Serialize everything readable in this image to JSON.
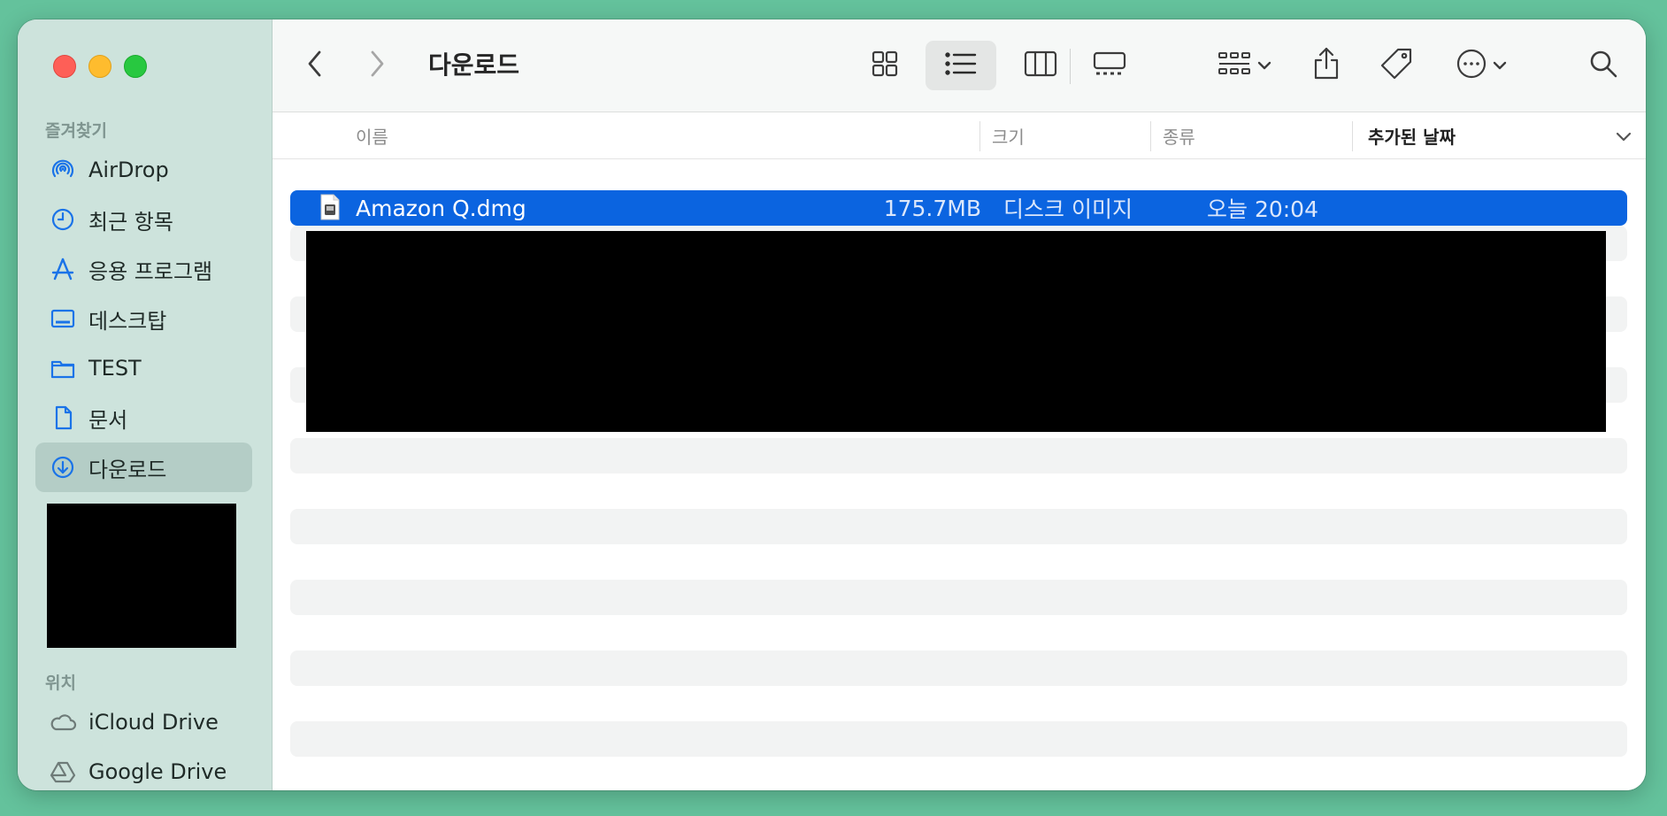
{
  "window": {
    "title": "다운로드"
  },
  "sidebar": {
    "favorites_title": "즐겨찾기",
    "favorites": [
      {
        "label": "AirDrop",
        "icon": "airdrop-icon"
      },
      {
        "label": "최근 항목",
        "icon": "clock-icon"
      },
      {
        "label": "응용 프로그램",
        "icon": "applications-icon"
      },
      {
        "label": "데스크탑",
        "icon": "desktop-icon"
      },
      {
        "label": "TEST",
        "icon": "folder-icon"
      },
      {
        "label": "문서",
        "icon": "document-icon"
      },
      {
        "label": "다운로드",
        "icon": "download-icon",
        "active": true
      }
    ],
    "locations_title": "위치",
    "locations": [
      {
        "label": "iCloud Drive",
        "icon": "icloud-icon"
      },
      {
        "label": "Google Drive",
        "icon": "google-drive-icon"
      }
    ]
  },
  "columns": {
    "name": "이름",
    "size": "크기",
    "kind": "종류",
    "date_added": "추가된 날짜"
  },
  "files": [
    {
      "name": "Amazon Q.dmg",
      "size": "175.7MB",
      "kind": "디스크 이미지",
      "date_added": "오늘 20:04",
      "selected": true
    }
  ],
  "colors": {
    "selection": "#0b64e0",
    "sidebar_bg": "#cde3dc",
    "accent_icon": "#1a73e8",
    "desktop_bg": "#64c29c"
  }
}
